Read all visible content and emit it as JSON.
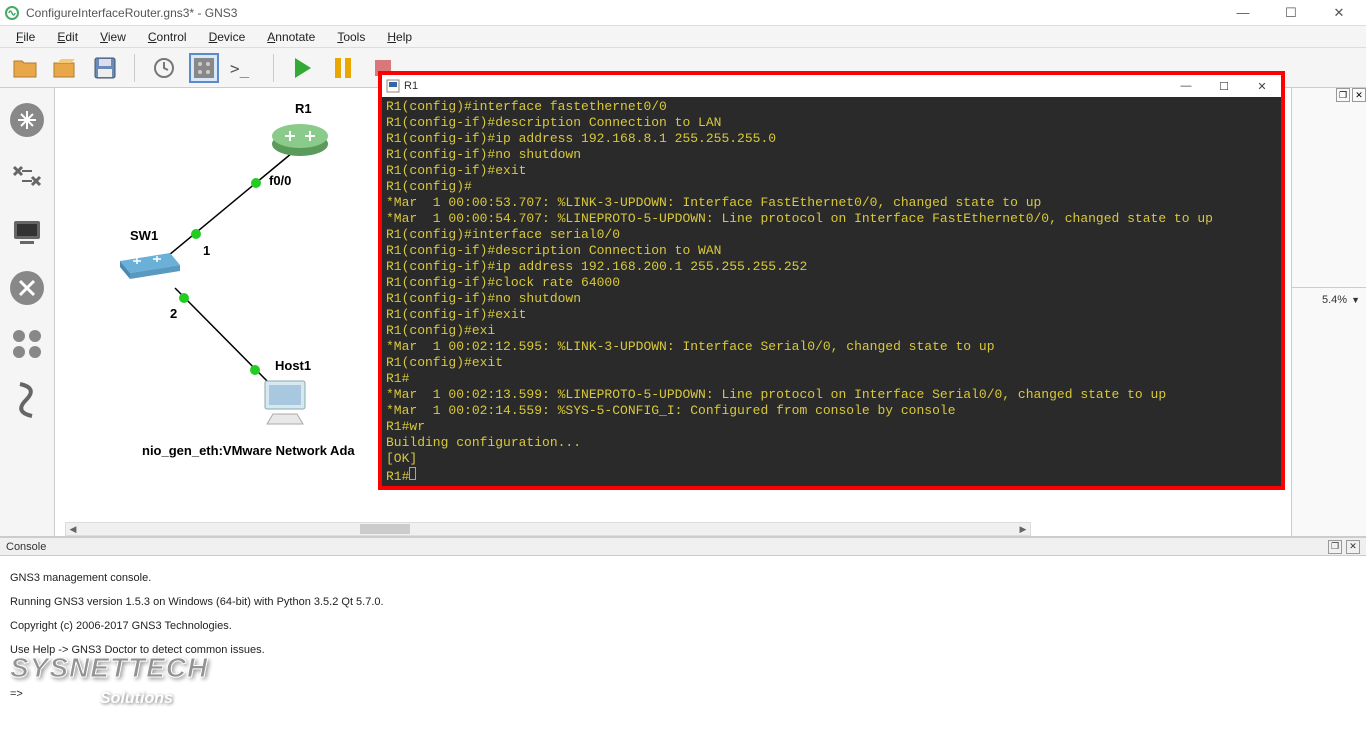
{
  "window": {
    "title": "ConfigureInterfaceRouter.gns3* - GNS3",
    "min": "—",
    "max": "☐",
    "close": "✕"
  },
  "menu": {
    "items": [
      "File",
      "Edit",
      "View",
      "Control",
      "Device",
      "Annotate",
      "Tools",
      "Help"
    ]
  },
  "topology": {
    "r1": "R1",
    "f00": "f0/0",
    "sw1": "SW1",
    "port1": "1",
    "port2": "2",
    "host1": "Host1",
    "nio": "nio_gen_eth:VMware Network Ada"
  },
  "right": {
    "zoom": "5.4%"
  },
  "console": {
    "title": "Console",
    "line1": "GNS3 management console.",
    "line2": "Running GNS3 version 1.5.3 on Windows (64-bit) with Python 3.5.2 Qt 5.7.0.",
    "line3": "Copyright (c) 2006-2017 GNS3 Technologies.",
    "line4": "Use Help -> GNS3 Doctor to detect common issues.",
    "prompt": "=>"
  },
  "terminal": {
    "title": "R1",
    "lines": [
      "R1(config)#interface fastethernet0/0",
      "R1(config-if)#description Connection to LAN",
      "R1(config-if)#ip address 192.168.8.1 255.255.255.0",
      "R1(config-if)#no shutdown",
      "R1(config-if)#exit",
      "R1(config)#",
      "*Mar  1 00:00:53.707: %LINK-3-UPDOWN: Interface FastEthernet0/0, changed state to up",
      "*Mar  1 00:00:54.707: %LINEPROTO-5-UPDOWN: Line protocol on Interface FastEthernet0/0, changed state to up",
      "R1(config)#interface serial0/0",
      "R1(config-if)#description Connection to WAN",
      "R1(config-if)#ip address 192.168.200.1 255.255.255.252",
      "R1(config-if)#clock rate 64000",
      "R1(config-if)#no shutdown",
      "R1(config-if)#exit",
      "R1(config)#exi",
      "*Mar  1 00:02:12.595: %LINK-3-UPDOWN: Interface Serial0/0, changed state to up",
      "R1(config)#exit",
      "R1#",
      "*Mar  1 00:02:13.599: %LINEPROTO-5-UPDOWN: Line protocol on Interface Serial0/0, changed state to up",
      "*Mar  1 00:02:14.559: %SYS-5-CONFIG_I: Configured from console by console",
      "R1#wr",
      "Building configuration...",
      "[OK]",
      "R1#"
    ]
  },
  "watermark": {
    "l1": "SYSNETTECH",
    "l2": "Solutions"
  }
}
